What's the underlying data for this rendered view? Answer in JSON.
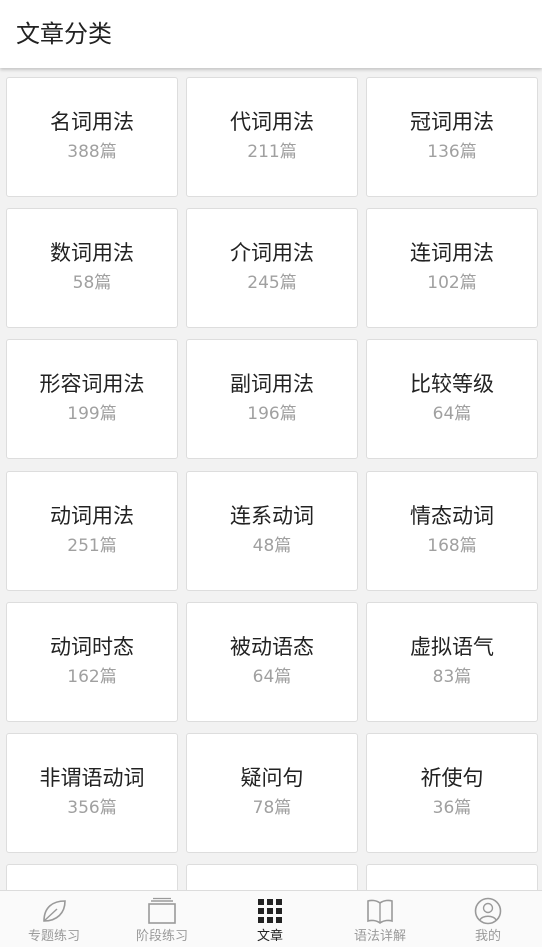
{
  "header": {
    "title": "文章分类"
  },
  "categories": [
    {
      "name": "名词用法",
      "count": "388篇"
    },
    {
      "name": "代词用法",
      "count": "211篇"
    },
    {
      "name": "冠词用法",
      "count": "136篇"
    },
    {
      "name": "数词用法",
      "count": "58篇"
    },
    {
      "name": "介词用法",
      "count": "245篇"
    },
    {
      "name": "连词用法",
      "count": "102篇"
    },
    {
      "name": "形容词用法",
      "count": "199篇"
    },
    {
      "name": "副词用法",
      "count": "196篇"
    },
    {
      "name": "比较等级",
      "count": "64篇"
    },
    {
      "name": "动词用法",
      "count": "251篇"
    },
    {
      "name": "连系动词",
      "count": "48篇"
    },
    {
      "name": "情态动词",
      "count": "168篇"
    },
    {
      "name": "动词时态",
      "count": "162篇"
    },
    {
      "name": "被动语态",
      "count": "64篇"
    },
    {
      "name": "虚拟语气",
      "count": "83篇"
    },
    {
      "name": "非谓语动词",
      "count": "356篇"
    },
    {
      "name": "疑问句",
      "count": "78篇"
    },
    {
      "name": "祈使句",
      "count": "36篇"
    }
  ],
  "tabs": [
    {
      "label": "专题练习",
      "icon": "leaf-icon"
    },
    {
      "label": "阶段练习",
      "icon": "stack-icon"
    },
    {
      "label": "文章",
      "icon": "grid-icon",
      "active": true
    },
    {
      "label": "语法详解",
      "icon": "book-icon"
    },
    {
      "label": "我的",
      "icon": "user-icon"
    }
  ],
  "colors": {
    "active": "#222222",
    "inactive": "#9a9a9a",
    "background": "#f2f2f2"
  }
}
